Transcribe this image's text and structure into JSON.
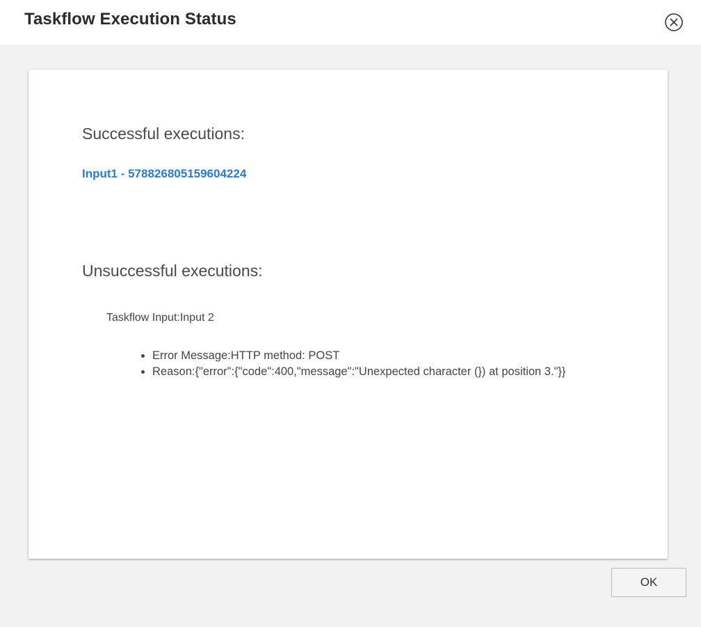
{
  "dialog": {
    "title": "Taskflow Execution Status",
    "close_icon": "close-circle-icon",
    "ok_label": "OK"
  },
  "successful": {
    "heading": "Successful executions:",
    "items": [
      {
        "label": "Input1 - 578826805159604224"
      }
    ]
  },
  "unsuccessful": {
    "heading": "Unsuccessful executions:",
    "items": [
      {
        "input_label": "Taskflow Input:Input 2",
        "details": [
          "Error Message:HTTP method: POST",
          "Reason:{\"error\":{\"code\":400,\"message\":\"Unexpected character (}) at position 3.\"}}"
        ]
      }
    ]
  },
  "colors": {
    "link": "#2a7ad6",
    "body_background": "#f2f2f2",
    "card_background": "#ffffff"
  }
}
